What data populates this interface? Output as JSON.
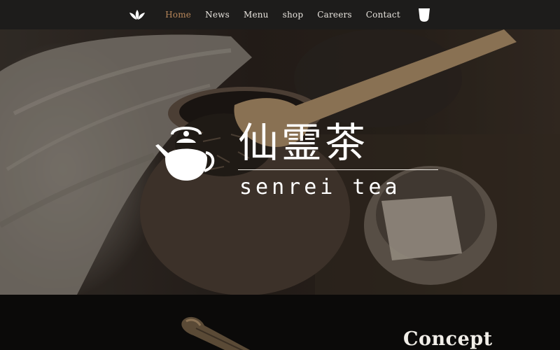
{
  "nav": {
    "logo_icon": "tea-leaves-icon",
    "items": [
      {
        "label": "Home",
        "active": true
      },
      {
        "label": "News",
        "active": false
      },
      {
        "label": "Menu",
        "active": false
      },
      {
        "label": "shop",
        "active": false
      },
      {
        "label": "Careers",
        "active": false
      },
      {
        "label": "Contact",
        "active": false
      }
    ],
    "cup_icon": "tea-cup-icon",
    "active_color": "#b8875a"
  },
  "hero": {
    "logo_icon": "teapot-icon",
    "brand_kanji": "仙霊茶",
    "brand_roman": "senrei tea"
  },
  "concept": {
    "title": "Concept"
  }
}
